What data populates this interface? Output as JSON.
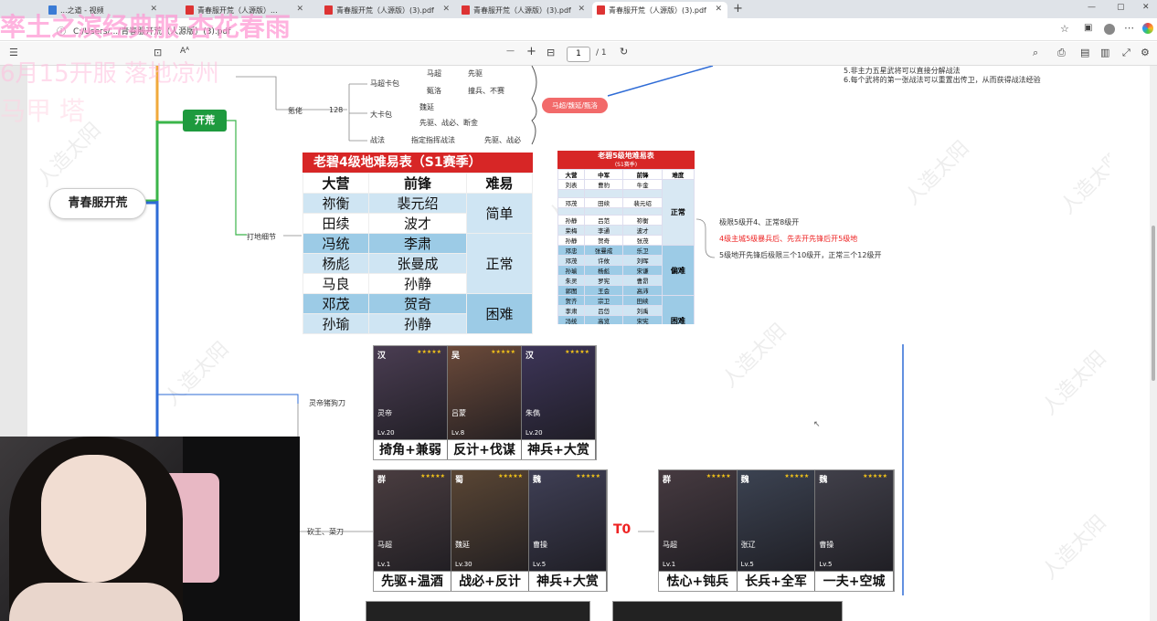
{
  "browser": {
    "tabs": [
      {
        "label": "...之道 - 视频"
      },
      {
        "label": "青春服开荒（人源版）..."
      },
      {
        "label": "青春服开荒（人源版）(3).pdf"
      },
      {
        "label": "青春服开荒（人源版）(3).pdf"
      },
      {
        "label": "青春服开荒（人源版）(3).pdf"
      }
    ],
    "url": "C:/Users/.../青春服开荒（人源版）(3).pdf",
    "new_tab": "+",
    "window_controls": [
      "—",
      "▢",
      "✕"
    ]
  },
  "pdf_toolbar": {
    "zoom_out": "—",
    "zoom_in": "+",
    "page_current": "1",
    "page_total": "/ 1"
  },
  "overlay": {
    "line1": "率土之滨经典服 杏花春雨",
    "line2": "6月15开服   落地凉州",
    "line3": "马甲 塔"
  },
  "mindmap": {
    "root": "青春服开荒",
    "branch": "开荒",
    "lords": "氪佬",
    "lords_num": "128",
    "maochao_pack": "马超卡包",
    "maochao": "马超",
    "vanguard": "先驱",
    "zhenluo": "甄洛",
    "zhenluo_tactic": "撞兵、不赛",
    "big_pack": "大卡包",
    "weiyan": "魏延",
    "weiyan_tactic": "先驱、战必、断金",
    "tactics": "战法",
    "tactics_desc": "指定指挥战法",
    "tactics_desc2": "先驱、战必",
    "pill": "马超/魏延/甄洛",
    "notes_top1": "5.非主力五星武将可以直接分解战法",
    "notes_top2": "6.每个武将的第一张战法可以重置出传卫，从而获得战法经验",
    "land_detail": "打地细节",
    "note_a": "极限5级开4、正常8级开",
    "note_b": "4级主城5级暴兵后、先去开先锋后开5级地",
    "note_c": "5级地开先锋后极限三个10级开，正常三个12级开",
    "lingdi": "灵帝猪狗刀",
    "kanwang": "砍王、菜刀",
    "t0": "T0"
  },
  "table4": {
    "title": "老碧4级地难易表（S1赛季）",
    "headers": [
      "大营",
      "前锋",
      "难易"
    ],
    "rows": [
      [
        "祢衡",
        "裴元绍"
      ],
      [
        "田续",
        "波才"
      ],
      [
        "冯统",
        "李肃"
      ],
      [
        "杨彪",
        "张曼成"
      ],
      [
        "马良",
        "孙静"
      ],
      [
        "邓茂",
        "贺奇"
      ],
      [
        "孙瑜",
        "孙静"
      ]
    ],
    "levels": [
      "简单",
      "正常",
      "困难"
    ]
  },
  "table5": {
    "title": "老碧5级地难易表",
    "subtitle": "(S1赛季)",
    "headers": [
      "大营",
      "中军",
      "前锋",
      "难度"
    ],
    "rows": [
      [
        "刘表",
        "曹豹",
        "牛金"
      ],
      [
        "",
        "",
        ""
      ],
      [
        "邓茂",
        "田续",
        "裴元绍"
      ],
      [
        "",
        "",
        ""
      ],
      [
        "孙静",
        "吕范",
        "祢衡"
      ],
      [
        "荣梅",
        "李通",
        "波才"
      ],
      [
        "孙静",
        "贺奇",
        "张茂"
      ],
      [
        "邓忠",
        "张曼成",
        "乐卫"
      ],
      [
        "邓茂",
        "许攸",
        "刘晖"
      ],
      [
        "孙瑜",
        "杨彪",
        "宋谦"
      ],
      [
        "朱灵",
        "罗宪",
        "曹昂"
      ],
      [
        "郭图",
        "王会",
        "高沛"
      ],
      [
        "贺齐",
        "宗卫",
        "田续"
      ],
      [
        "李肃",
        "吕岱",
        "刘禹"
      ],
      [
        "冯统",
        "高览",
        "宋宪"
      ],
      [
        "魏续",
        "王烈",
        "曹洪"
      ],
      [
        "荣梅",
        "韩馥",
        "张曼成"
      ]
    ],
    "levels": [
      "正常",
      "偏难",
      "困难"
    ]
  },
  "strips": [
    {
      "cards": [
        {
          "faction": "汉",
          "name": "灵帝",
          "lv": "Lv.20",
          "cap": "掎角+兼弱"
        },
        {
          "faction": "吴",
          "name": "吕蒙",
          "lv": "Lv.8",
          "cap": "反计+伐谋"
        },
        {
          "faction": "汉",
          "name": "朱儁",
          "lv": "Lv.20",
          "cap": "神兵+大赏"
        }
      ]
    },
    {
      "cards": [
        {
          "faction": "群",
          "name": "马超",
          "lv": "Lv.1",
          "cap": "先驱+温酒"
        },
        {
          "faction": "蜀",
          "name": "魏延",
          "lv": "Lv.30",
          "cap": "战必+反计"
        },
        {
          "faction": "魏",
          "name": "曹操",
          "lv": "Lv.5",
          "cap": "神兵+大赏"
        }
      ]
    },
    {
      "cards": [
        {
          "faction": "群",
          "name": "马超",
          "lv": "Lv.1",
          "cap": "怯心+钝兵"
        },
        {
          "faction": "魏",
          "name": "张辽",
          "lv": "Lv.5",
          "cap": "长兵+全军"
        },
        {
          "faction": "魏",
          "name": "曹操",
          "lv": "Lv.5",
          "cap": "一夫+空城"
        }
      ]
    }
  ],
  "watermark": "人造太阳"
}
